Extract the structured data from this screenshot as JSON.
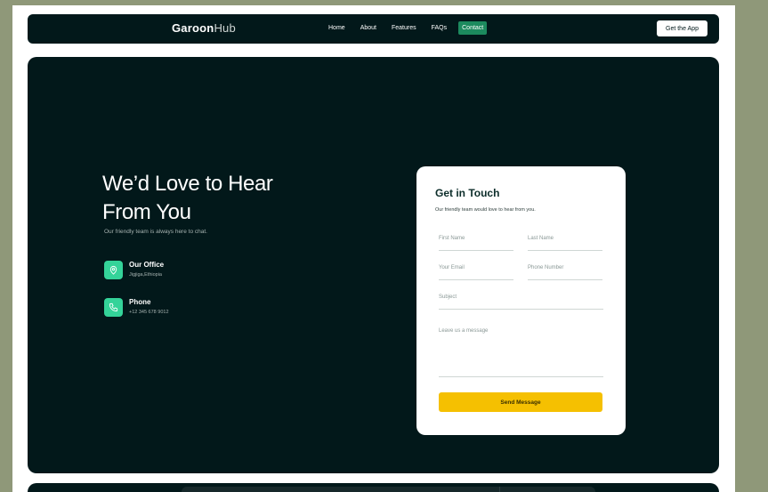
{
  "navbar": {
    "logo_bold": "Garoon",
    "logo_light": "Hub",
    "links": [
      "Home",
      "About",
      "Features",
      "FAQs",
      "Contact"
    ],
    "active_link": "Contact",
    "cta": "Get the App"
  },
  "hero": {
    "headline": "We’d Love to Hear From You",
    "subline": "Our friendly team is always here to chat.",
    "office": {
      "title": "Our Office",
      "value": "Jigjiga,Ethiopia",
      "icon": "location-pin-icon"
    },
    "phone": {
      "title": "Phone",
      "value": "+12 345 678 9012",
      "icon": "phone-icon"
    }
  },
  "form": {
    "title": "Get in Touch",
    "subtitle": "Our friendly team would love to hear from you.",
    "first_name_placeholder": "First Name",
    "last_name_placeholder": "Last Name",
    "email_placeholder": "Your Email",
    "phone_placeholder": "Phone Number",
    "subject_placeholder": "Subject",
    "message_placeholder": "Leave us a message",
    "submit_label": "Send Message"
  },
  "colors": {
    "background": "#8f9879",
    "dark": "#02181a",
    "accent_green": "#34d399",
    "active_nav": "#1c8a5e",
    "button_yellow": "#f5c001"
  }
}
